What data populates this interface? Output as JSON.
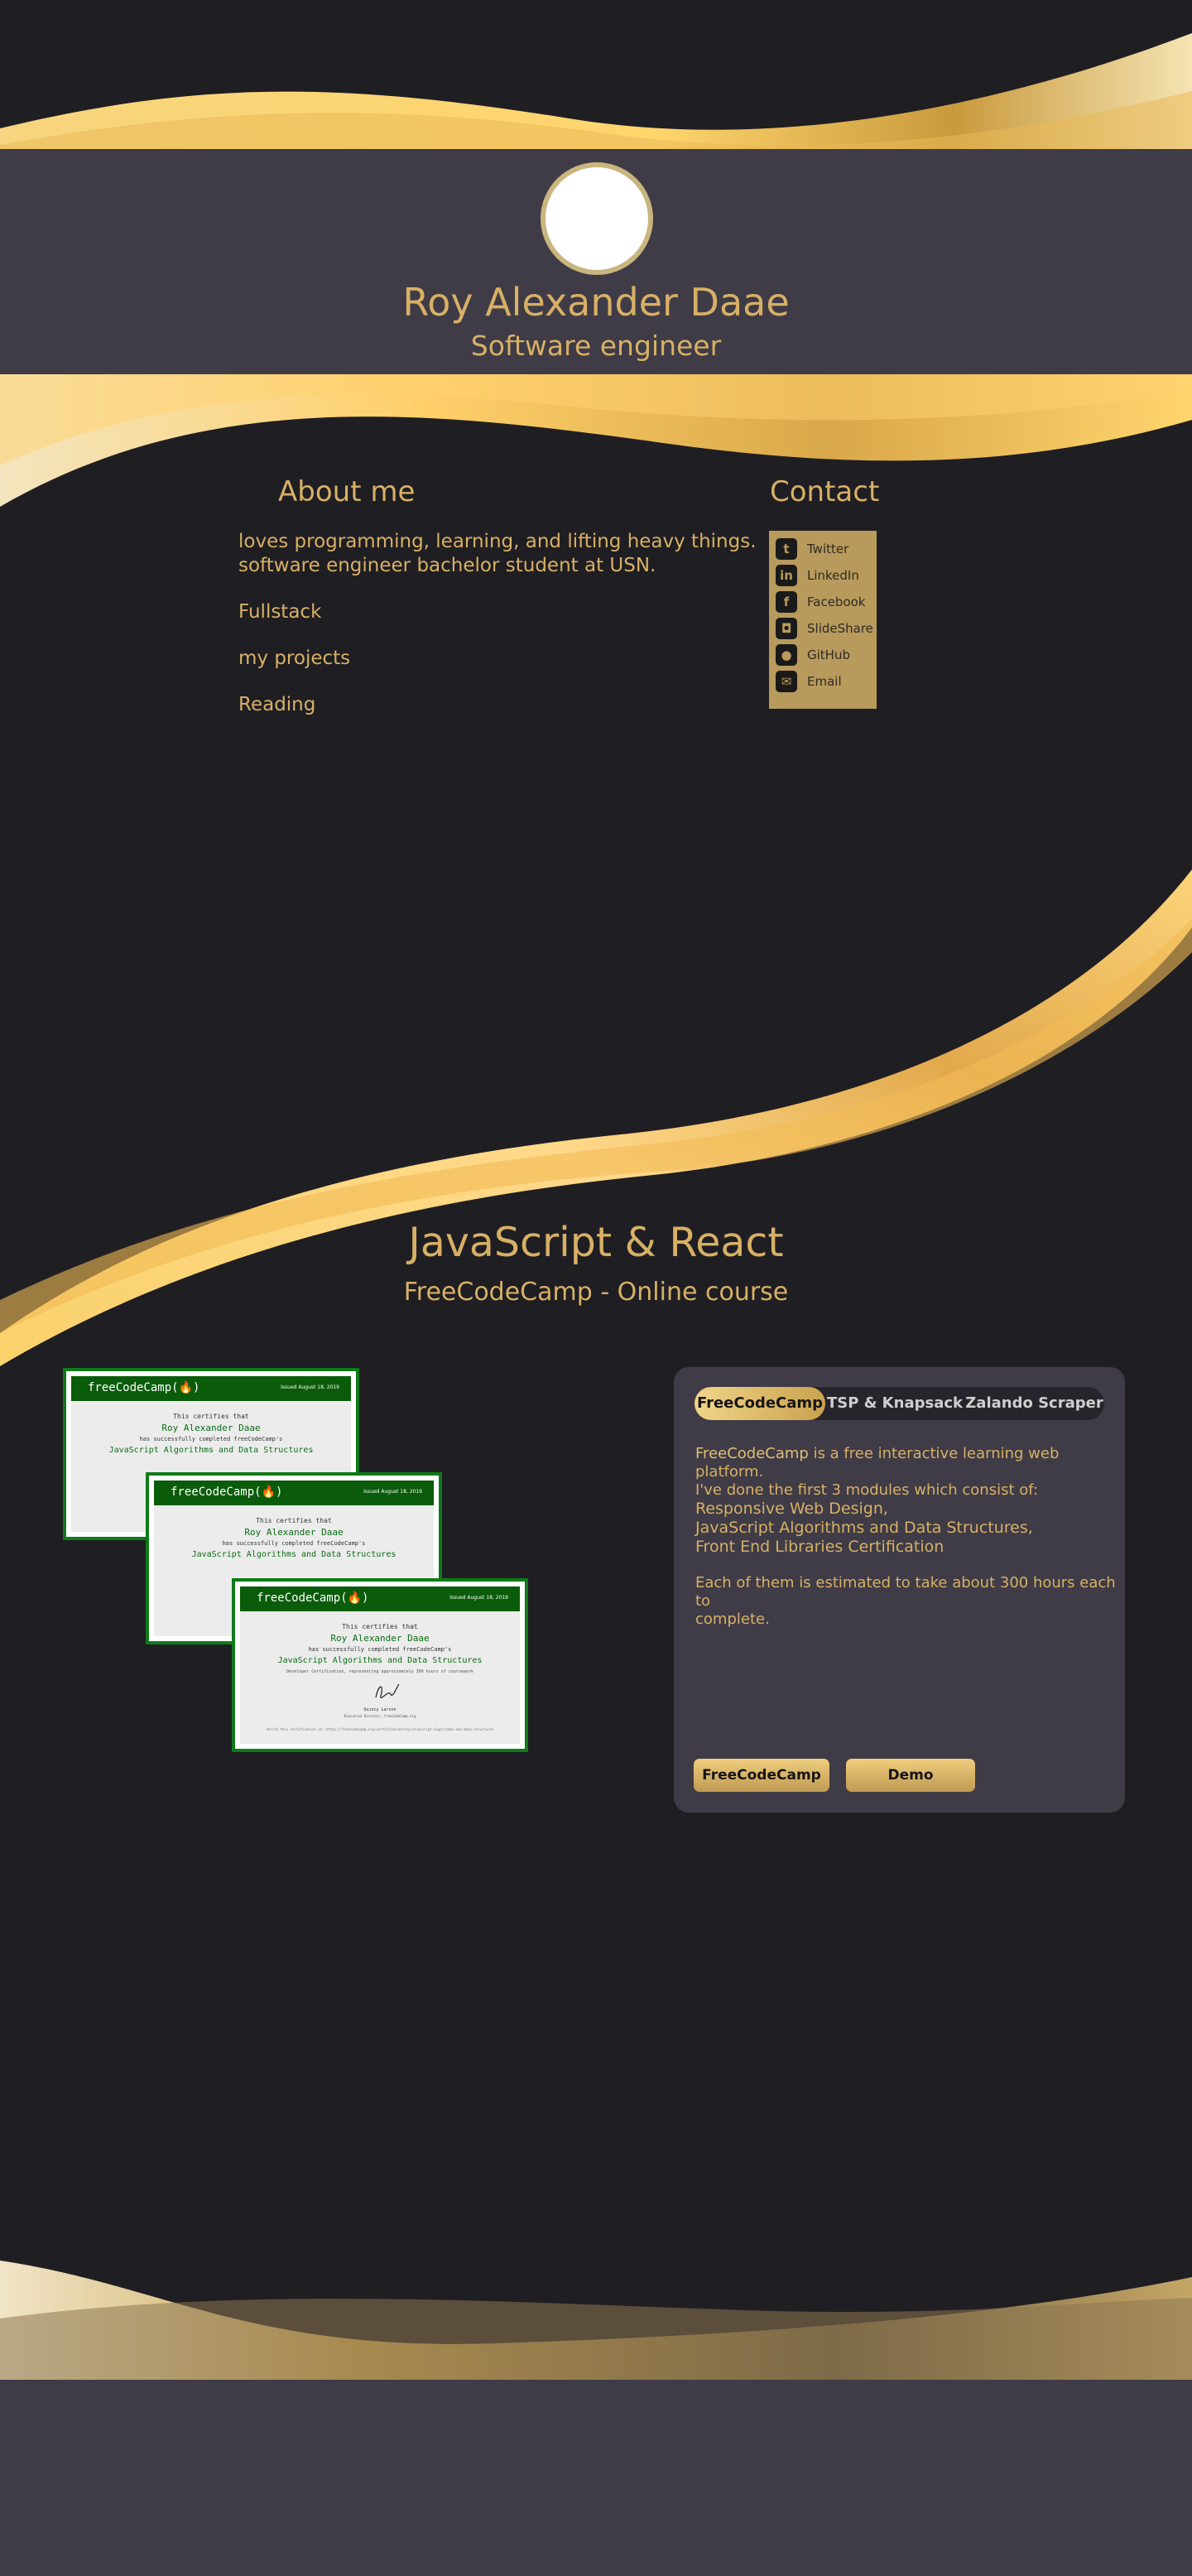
{
  "header": {
    "name": "Roy Alexander Daae",
    "role": "Software engineer"
  },
  "about": {
    "title": "About me",
    "line1": "loves programming, learning, and lifting heavy things.",
    "line2": "software engineer bachelor student at USN.",
    "links": [
      "Fullstack",
      "my projects",
      "Reading"
    ]
  },
  "contact": {
    "title": "Contact",
    "items": [
      {
        "label": "Twitter",
        "icon": "twitter-icon"
      },
      {
        "label": "LinkedIn",
        "icon": "linkedin-icon"
      },
      {
        "label": "Facebook",
        "icon": "facebook-icon"
      },
      {
        "label": "SlideShare",
        "icon": "slideshare-icon"
      },
      {
        "label": "GitHub",
        "icon": "github-icon"
      },
      {
        "label": "Email",
        "icon": "email-icon"
      }
    ]
  },
  "project": {
    "title": "JavaScript & React",
    "subtitle": "FreeCodeCamp - Online course",
    "certificate": {
      "logo": "freeCodeCamp(🔥)",
      "date": "Issued August 18, 2019",
      "certifies": "This certifies that",
      "holder": "Roy Alexander Daae",
      "completed": "has successfully completed freeCodeCamp's",
      "course": "JavaScript Algorithms and Data Structures",
      "hours": "Developer Certification, representing approximately 300 hours of coursework",
      "signer": "Quincy Larson",
      "signer_title": "Executive Director, freeCodeCamp.org",
      "verify": "Verify this certification at: https://freecodecamp.org/certification/roy/javascript-algorithms-and-data-structures"
    },
    "tabs": [
      "FreeCodeCamp",
      "TSP & Knapsack",
      "Zalando Scraper"
    ],
    "description": {
      "highlight": "FreeCodeCamp",
      "line1_rest": " is a free interactive learning web platform.",
      "line2": "I've done the first 3 modules which consist of:",
      "modules": [
        "Responsive Web Design,",
        "JavaScript Algorithms and Data Structures,",
        "Front End Libraries Certification"
      ],
      "hours_line1": "Each of them is estimated to take about 300 hours each to",
      "hours_line2": "complete."
    },
    "buttons": [
      "FreeCodeCamp",
      "Demo"
    ]
  },
  "colors": {
    "background": "#1f1e23",
    "band": "#3f3c47",
    "gold": "#d8b065",
    "certificate_green": "#0a5c0a"
  }
}
